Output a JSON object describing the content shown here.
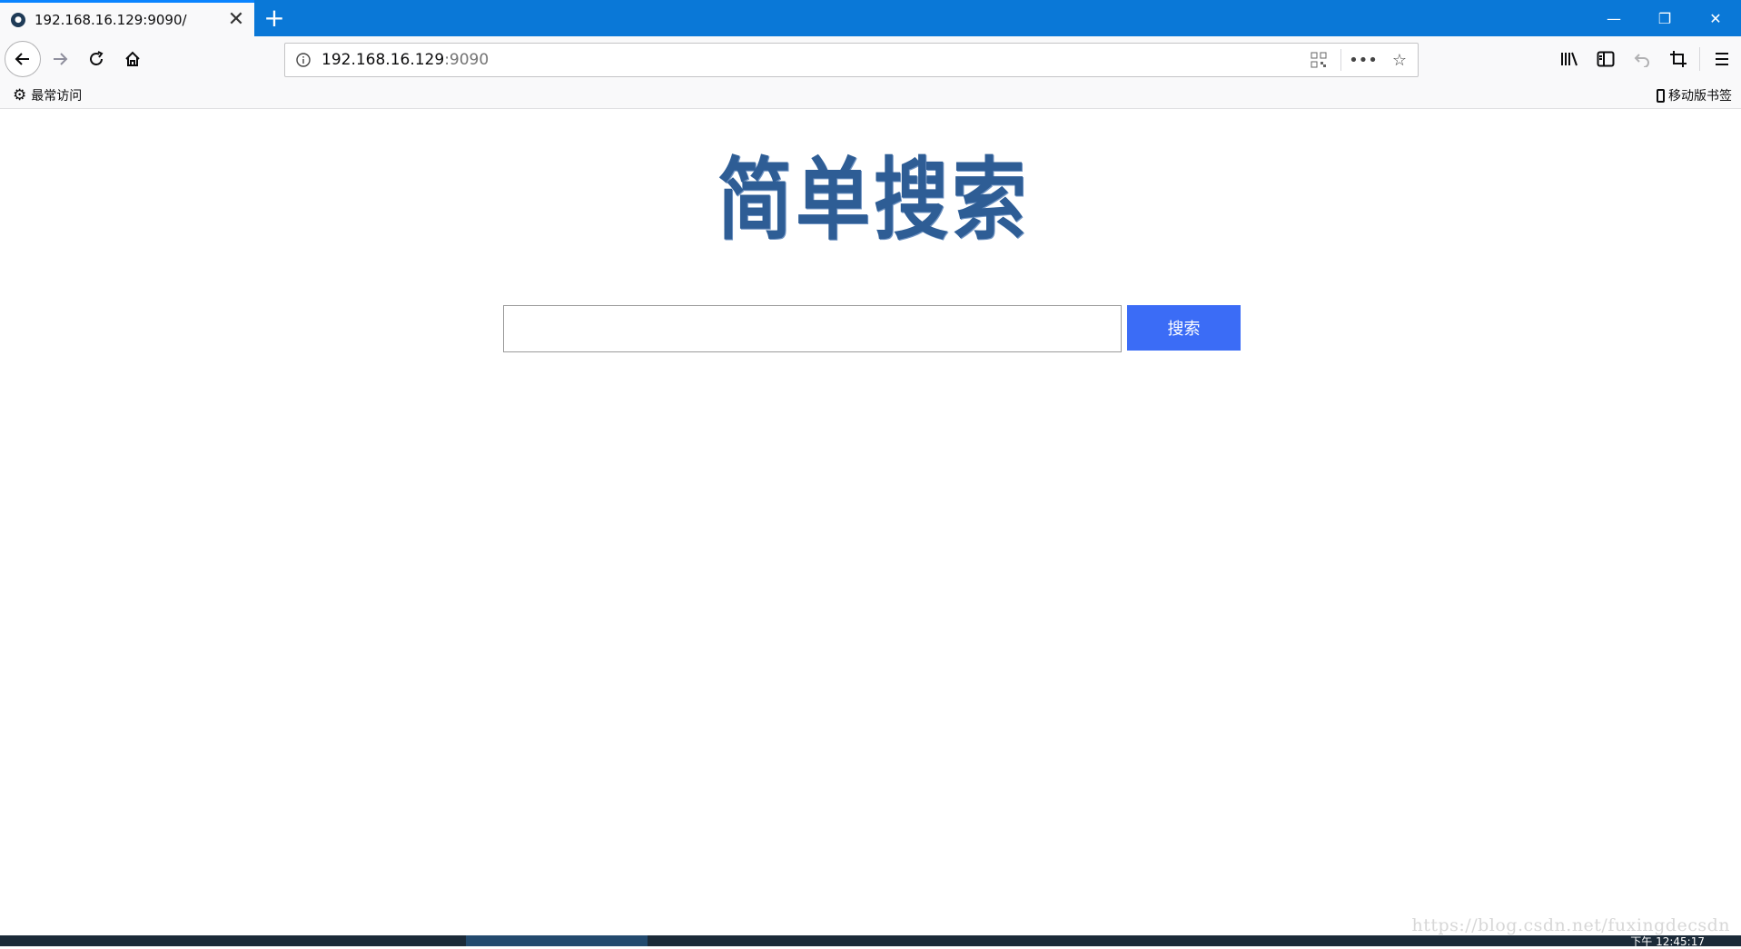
{
  "browser": {
    "tab_title": "192.168.16.129:9090/",
    "url_host": "192.168.16.129",
    "url_port": ":9090",
    "bookmarks_left": "最常访问",
    "bookmarks_right": "移动版书签"
  },
  "page": {
    "logo_text": "简单搜索",
    "search_placeholder": "",
    "search_button_label": "搜索"
  },
  "taskbar": {
    "clock": "下午 12:45:17"
  },
  "watermark": "https://blog.csdn.net/fuxingdecsdn",
  "colors": {
    "titlebar": "#0a78d7",
    "search_button": "#3b6cf6",
    "logo": "#2e5d95"
  }
}
